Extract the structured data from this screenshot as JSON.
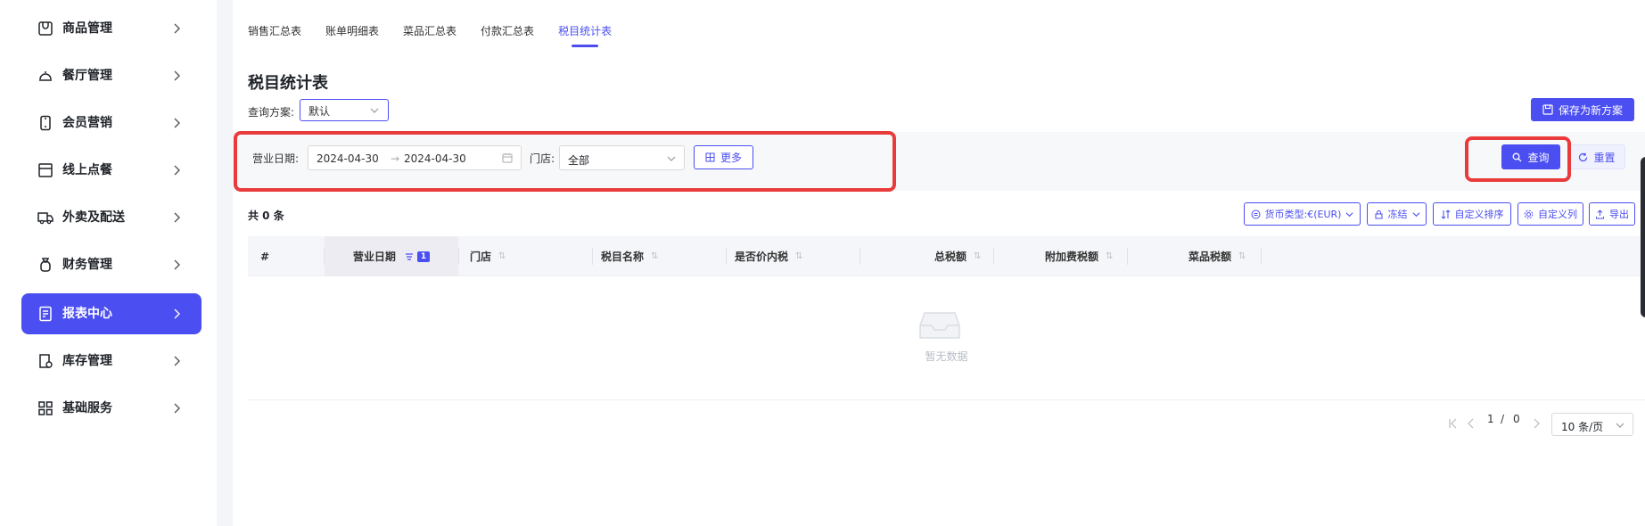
{
  "sidebar": {
    "items": [
      {
        "label": "商品管理",
        "icon": "package-icon"
      },
      {
        "label": "餐厅管理",
        "icon": "dish-cover-icon"
      },
      {
        "label": "会员营销",
        "icon": "phone-icon"
      },
      {
        "label": "线上点餐",
        "icon": "store-icon"
      },
      {
        "label": "外卖及配送",
        "icon": "truck-icon"
      },
      {
        "label": "财务管理",
        "icon": "money-bag-icon"
      },
      {
        "label": "报表中心",
        "icon": "report-icon",
        "active": true
      },
      {
        "label": "库存管理",
        "icon": "inventory-icon"
      },
      {
        "label": "基础服务",
        "icon": "grid-icon"
      }
    ]
  },
  "tabs": [
    "销售汇总表",
    "账单明细表",
    "菜品汇总表",
    "付款汇总表",
    "税目统计表"
  ],
  "active_tab": "税目统计表",
  "page_title": "税目统计表",
  "scheme": {
    "label": "查询方案:",
    "value": "默认",
    "save_label": "保存为新方案"
  },
  "filters": {
    "date_label": "营业日期:",
    "date_start": "2024-04-30",
    "date_end": "2024-04-30",
    "date_sep": "→",
    "store_label": "门店:",
    "store_value": "全部",
    "more_label": "更多",
    "query_label": "查询",
    "reset_label": "重置"
  },
  "total_text": "共 0 条",
  "toolbar": {
    "currency_label": "货币类型:€(EUR)",
    "freeze_label": "冻结",
    "custom_sort_label": "自定义排序",
    "custom_columns_label": "自定义列",
    "export_label": "导出"
  },
  "table": {
    "columns": [
      "#",
      "营业日期",
      "门店",
      "税目名称",
      "是否价内税",
      "总税额",
      "附加费税额",
      "菜品税额"
    ],
    "sort_badge": "1",
    "empty_text": "暂无数据"
  },
  "pagination": {
    "current": "1",
    "sep": "/",
    "total": "0",
    "page_size": "10 条/页"
  },
  "colors": {
    "accent": "#4b4ef0",
    "highlight": "#e93b3b"
  }
}
